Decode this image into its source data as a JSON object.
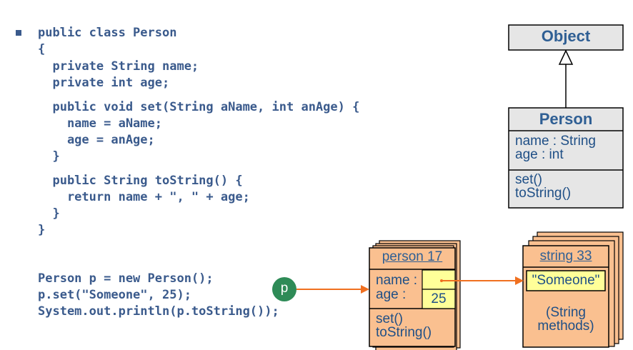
{
  "code": {
    "class_lines": [
      "public class Person",
      "{",
      "  private String name;",
      "  private int age;",
      "  public void set(String aName, int anAge) {",
      "    name = aName;",
      "    age = anAge;",
      "  }",
      "  public String toString() {",
      "    return name + \", \" + age;",
      "  }",
      "}"
    ],
    "main_lines": [
      "Person p = new Person();",
      "p.set(\"Someone\", 25);",
      "System.out.println(p.toString());"
    ]
  },
  "uml": {
    "object_title": "Object",
    "person_title": "Person",
    "attributes": [
      "name : String",
      "age : int"
    ],
    "methods": [
      "set()",
      "toString()"
    ]
  },
  "instances": {
    "reference_var": "p",
    "person_title": "person 17",
    "person_fields": [
      "name :",
      "age :"
    ],
    "age_value": "25",
    "person_methods": [
      "set()",
      "toString()"
    ],
    "string_title": "string 33",
    "string_value": "\"Someone\"",
    "string_methods_lines": [
      "(String",
      "methods)"
    ]
  },
  "colors": {
    "code_text": "#3a5a8c",
    "uml_fill": "#e6e6e6",
    "object_fill": "#fac090",
    "value_fill": "#ffff99",
    "arrow": "#f07020",
    "ref_circle": "#2e8b57"
  }
}
